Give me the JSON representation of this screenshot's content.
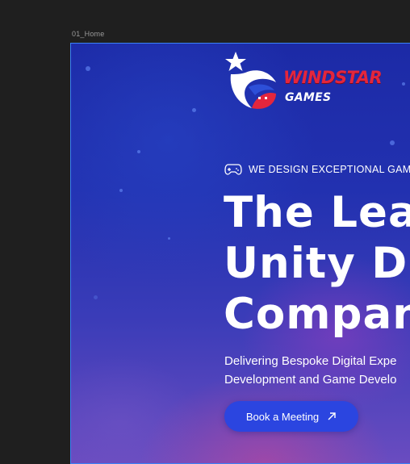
{
  "frame": {
    "label": "01_Home"
  },
  "logo": {
    "word1": "WINDSTAR",
    "word2": "GAMES",
    "colors": {
      "red": "#e3263d",
      "white": "#ffffff"
    }
  },
  "hero": {
    "tagline_icon": "gamepad-icon",
    "tagline": "WE DESIGN EXCEPTIONAL GAMES",
    "headline": [
      "The Lea",
      "Unity D",
      "Compan"
    ],
    "subtitle": [
      "Delivering Bespoke Digital Expe",
      "Development and Game Develo"
    ],
    "cta": {
      "label": "Book a Meeting",
      "icon": "arrow-up-right-icon",
      "color": "#2b45e0"
    }
  }
}
